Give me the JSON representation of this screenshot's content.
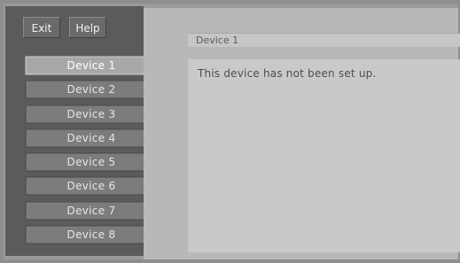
{
  "toolbar": {
    "exit_label": "Exit",
    "help_label": "Help"
  },
  "devices": [
    {
      "label": "Device 1",
      "active": true
    },
    {
      "label": "Device 2",
      "active": false
    },
    {
      "label": "Device 3",
      "active": false
    },
    {
      "label": "Device 4",
      "active": false
    },
    {
      "label": "Device 5",
      "active": false
    },
    {
      "label": "Device 6",
      "active": false
    },
    {
      "label": "Device 7",
      "active": false
    },
    {
      "label": "Device 8",
      "active": false
    }
  ],
  "panel": {
    "title": "Device 1",
    "message": "This device has not been set up."
  },
  "colors": {
    "tab_active": "#a8a8a8",
    "tab_inactive": "#7c7c7c",
    "tab_border_light": "#d0d0d0",
    "tab_border_dark": "#4a4a4a"
  }
}
